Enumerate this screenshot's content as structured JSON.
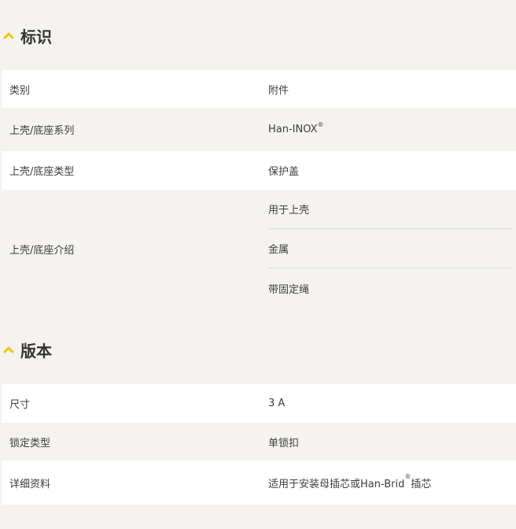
{
  "sections": [
    {
      "title": "标识",
      "rows": [
        {
          "label": "类别",
          "value": "附件"
        },
        {
          "label": "上壳/底座系列",
          "value": "Han-INOX",
          "sup": "®"
        },
        {
          "label": "上壳/底座类型",
          "value": "保护盖"
        },
        {
          "label": "上壳/底座介绍",
          "values": [
            "用于上壳",
            "金属",
            "带固定绳"
          ]
        }
      ]
    },
    {
      "title": "版本",
      "rows": [
        {
          "label": "尺寸",
          "value": "3 A"
        },
        {
          "label": "锁定类型",
          "value": "单锁扣"
        },
        {
          "label": "详细资料",
          "value": "适用于安装母插芯或Han-Brid",
          "sup": "®",
          "value_suffix": "插芯"
        }
      ]
    }
  ],
  "colors": {
    "accent": "#f5c400",
    "row_white": "#ffffff",
    "row_grey": "#f4f3f0"
  },
  "icons": {
    "section_toggle": "chevron-up-icon"
  }
}
